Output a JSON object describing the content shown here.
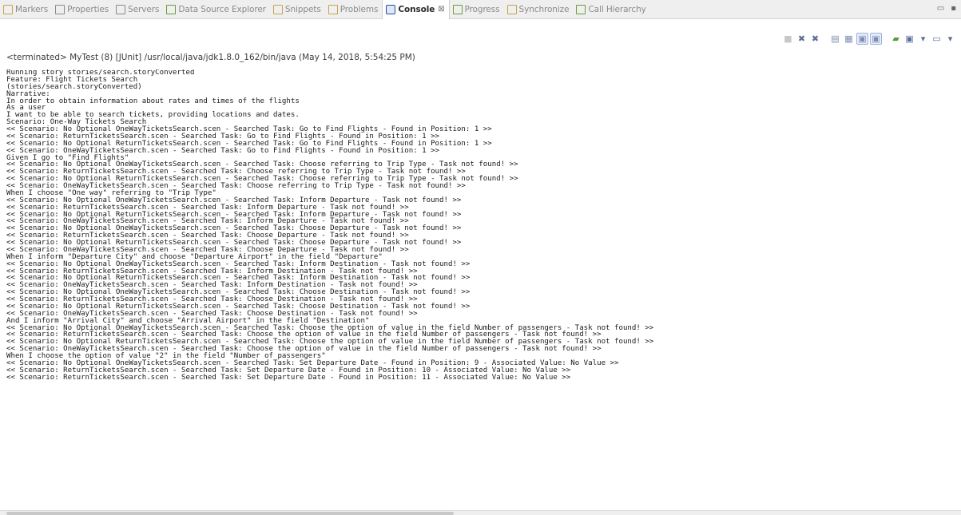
{
  "tabs": [
    {
      "label": "Markers",
      "icon": "markers-icon",
      "color": "#c9a24a",
      "active": false
    },
    {
      "label": "Properties",
      "icon": "properties-icon",
      "color": "#8a8a8a",
      "active": false
    },
    {
      "label": "Servers",
      "icon": "servers-icon",
      "color": "#8a8a8a",
      "active": false
    },
    {
      "label": "Data Source Explorer",
      "icon": "data-source-icon",
      "color": "#6d9a3d",
      "active": false
    },
    {
      "label": "Snippets",
      "icon": "snippets-icon",
      "color": "#c9a24a",
      "active": false
    },
    {
      "label": "Problems",
      "icon": "problems-icon",
      "color": "#c9a24a",
      "active": false
    },
    {
      "label": "Console",
      "icon": "console-icon",
      "color": "#1f4fa0",
      "active": true,
      "close": "⊠"
    },
    {
      "label": "Progress",
      "icon": "progress-icon",
      "color": "#6d9a3d",
      "active": false
    },
    {
      "label": "Synchronize",
      "icon": "synchronize-icon",
      "color": "#c9a24a",
      "active": false
    },
    {
      "label": "Call Hierarchy",
      "icon": "call-hierarchy-icon",
      "color": "#6d9a3d",
      "active": false
    }
  ],
  "window_controls": {
    "minimize": "▭",
    "maximize": "▪"
  },
  "toolbar": [
    {
      "icon": "terminate-icon",
      "glyph": "■",
      "color": "#c7c7c7",
      "pressed": false
    },
    {
      "icon": "remove-launch-icon",
      "glyph": "✖",
      "color": "#5c6e9a",
      "pressed": false
    },
    {
      "icon": "remove-all-launches-icon",
      "glyph": "✖",
      "color": "#5c6e9a",
      "pressed": false
    },
    {
      "sep": true
    },
    {
      "icon": "clear-console-icon",
      "glyph": "▤",
      "color": "#7b8cb0",
      "pressed": false
    },
    {
      "icon": "scroll-lock-icon",
      "glyph": "▦",
      "color": "#7b8cb0",
      "pressed": false
    },
    {
      "icon": "word-wrap-icon",
      "glyph": "▣",
      "color": "#7b8cb0",
      "pressed": true
    },
    {
      "icon": "show-on-output-icon",
      "glyph": "▣",
      "color": "#7b8cb0",
      "pressed": true
    },
    {
      "sep": true
    },
    {
      "icon": "pin-console-icon",
      "glyph": "▰",
      "color": "#5a9a3a",
      "pressed": false
    },
    {
      "icon": "display-console-icon",
      "glyph": "▣",
      "color": "#5c6e9a",
      "pressed": false
    },
    {
      "icon": "dropdown-arrow-icon",
      "glyph": "▾",
      "color": "#5c6e9a",
      "pressed": false
    },
    {
      "icon": "open-console-icon",
      "glyph": "▭",
      "color": "#5c6e9a",
      "pressed": false
    },
    {
      "icon": "dropdown-arrow-icon",
      "glyph": "▾",
      "color": "#5c6e9a",
      "pressed": false
    }
  ],
  "status": "<terminated> MyTest (8) [JUnit] /usr/local/java/jdk1.8.0_162/bin/java (May 14, 2018, 5:54:25 PM)",
  "lines": [
    "Running story stories/search.storyConverted",
    "Feature: Flight Tickets Search",
    "(stories/search.storyConverted)",
    "Narrative:",
    "In order to obtain information about rates and times of the flights",
    "As a user",
    "I want to be able to search tickets, providing locations and dates.",
    "Scenario: One-Way Tickets Search",
    "<< Scenario: No Optional OneWayTicketsSearch.scen - Searched Task: Go to Find Flights - Found in Position: 1 >>",
    "<< Scenario: ReturnTicketsSearch.scen - Searched Task: Go to Find Flights - Found in Position: 1 >>",
    "<< Scenario: No Optional ReturnTicketsSearch.scen - Searched Task: Go to Find Flights - Found in Position: 1 >>",
    "<< Scenario: OneWayTicketsSearch.scen - Searched Task: Go to Find Flights - Found in Position: 1 >>",
    "Given I go to \"Find Flights\"",
    "<< Scenario: No Optional OneWayTicketsSearch.scen - Searched Task: Choose referring to Trip Type - Task not found! >>",
    "<< Scenario: ReturnTicketsSearch.scen - Searched Task: Choose referring to Trip Type - Task not found! >>",
    "<< Scenario: No Optional ReturnTicketsSearch.scen - Searched Task: Choose referring to Trip Type - Task not found! >>",
    "<< Scenario: OneWayTicketsSearch.scen - Searched Task: Choose referring to Trip Type - Task not found! >>",
    "When I choose \"One way\" referring to \"Trip Type\"",
    "<< Scenario: No Optional OneWayTicketsSearch.scen - Searched Task: Inform Departure - Task not found! >>",
    "<< Scenario: ReturnTicketsSearch.scen - Searched Task: Inform Departure - Task not found! >>",
    "<< Scenario: No Optional ReturnTicketsSearch.scen - Searched Task: Inform Departure - Task not found! >>",
    "<< Scenario: OneWayTicketsSearch.scen - Searched Task: Inform Departure - Task not found! >>",
    "<< Scenario: No Optional OneWayTicketsSearch.scen - Searched Task: Choose Departure - Task not found! >>",
    "<< Scenario: ReturnTicketsSearch.scen - Searched Task: Choose Departure - Task not found! >>",
    "<< Scenario: No Optional ReturnTicketsSearch.scen - Searched Task: Choose Departure - Task not found! >>",
    "<< Scenario: OneWayTicketsSearch.scen - Searched Task: Choose Departure - Task not found! >>",
    "When I inform \"Departure City\" and choose \"Departure Airport\" in the field \"Departure\"",
    "<< Scenario: No Optional OneWayTicketsSearch.scen - Searched Task: Inform Destination - Task not found! >>",
    "<< Scenario: ReturnTicketsSearch.scen - Searched Task: Inform Destination - Task not found! >>",
    "<< Scenario: No Optional ReturnTicketsSearch.scen - Searched Task: Inform Destination - Task not found! >>",
    "<< Scenario: OneWayTicketsSearch.scen - Searched Task: Inform Destination - Task not found! >>",
    "<< Scenario: No Optional OneWayTicketsSearch.scen - Searched Task: Choose Destination - Task not found! >>",
    "<< Scenario: ReturnTicketsSearch.scen - Searched Task: Choose Destination - Task not found! >>",
    "<< Scenario: No Optional ReturnTicketsSearch.scen - Searched Task: Choose Destination - Task not found! >>",
    "<< Scenario: OneWayTicketsSearch.scen - Searched Task: Choose Destination - Task not found! >>",
    "And I inform \"Arrival City\" and choose \"Arrival Airport\" in the field \"Destination\"",
    "<< Scenario: No Optional OneWayTicketsSearch.scen - Searched Task: Choose the option of value in the field Number of passengers - Task not found! >>",
    "<< Scenario: ReturnTicketsSearch.scen - Searched Task: Choose the option of value in the field Number of passengers - Task not found! >>",
    "<< Scenario: No Optional ReturnTicketsSearch.scen - Searched Task: Choose the option of value in the field Number of passengers - Task not found! >>",
    "<< Scenario: OneWayTicketsSearch.scen - Searched Task: Choose the option of value in the field Number of passengers - Task not found! >>",
    "When I choose the option of value \"2\" in the field \"Number of passengers\"",
    "<< Scenario: No Optional OneWayTicketsSearch.scen - Searched Task: Set Departure Date - Found in Position: 9 - Associated Value: No Value >>",
    "<< Scenario: ReturnTicketsSearch.scen - Searched Task: Set Departure Date - Found in Position: 10 - Associated Value: No Value >>",
    "<< Scenario: ReturnTicketsSearch.scen - Searched Task: Set Departure Date - Found in Position: 11 - Associated Value: No Value >>"
  ]
}
